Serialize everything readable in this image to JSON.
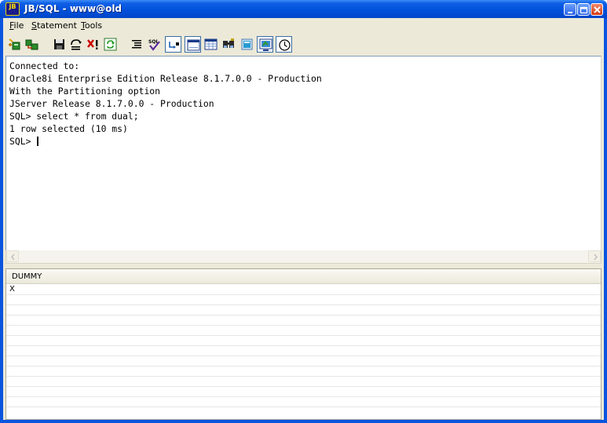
{
  "window": {
    "app_icon": "JB",
    "title": "JB/SQL - www@old"
  },
  "title_buttons": [
    "minimize-icon",
    "restore-icon",
    "close-icon"
  ],
  "menu": {
    "items": [
      {
        "prefix": "",
        "accel": "F",
        "rest": "ile"
      },
      {
        "prefix": "",
        "accel": "S",
        "rest": "tatement"
      },
      {
        "prefix": "",
        "accel": "T",
        "rest": "ools"
      }
    ]
  },
  "toolbar": {
    "icons": [
      "connect-icon",
      "disconnect-icon",
      "save-icon",
      "commit-icon",
      "rollback-icon",
      "refresh-icon",
      "format-icon",
      "sql-check-icon",
      "step-icon",
      "single-record-icon",
      "grid-view-icon",
      "binoculars-icon",
      "table-icon",
      "export-icon",
      "clock-icon"
    ]
  },
  "editor": {
    "lines": [
      "Connected to:",
      "Oracle8i Enterprise Edition Release 8.1.7.0.0 - Production",
      "With the Partitioning option",
      "JServer Release 8.1.7.0.0 - Production",
      "SQL> select * from dual;",
      "1 row selected (10 ms)"
    ],
    "prompt": "SQL> "
  },
  "results": {
    "columns": [
      "DUMMY"
    ],
    "rows": [
      [
        "X"
      ]
    ]
  },
  "colors": {
    "titlebar": "#0250da",
    "face": "#ece9d8"
  }
}
